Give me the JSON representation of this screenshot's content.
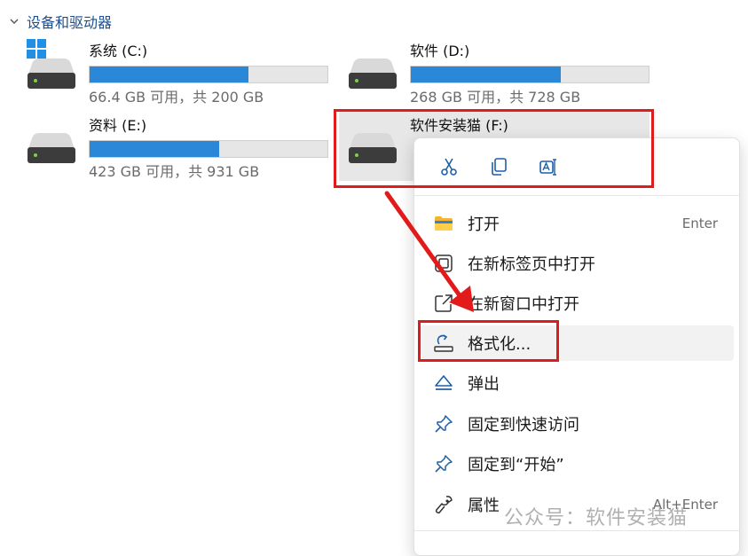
{
  "section": {
    "title": "设备和驱动器"
  },
  "drives": [
    {
      "name": "系统 (C:)",
      "space": "66.4 GB 可用，共 200 GB",
      "used_fraction": 0.668,
      "has_windows_logo": true
    },
    {
      "name": "软件 (D:)",
      "space": "268 GB 可用，共 728 GB",
      "used_fraction": 0.632
    },
    {
      "name": "资料 (E:)",
      "space": "423 GB 可用，共 931 GB",
      "used_fraction": 0.545
    },
    {
      "name": "软件安装猫 (F:)",
      "selected": true
    }
  ],
  "context_menu": {
    "quick_actions": [
      {
        "icon": "cut-icon"
      },
      {
        "icon": "copy-icon"
      },
      {
        "icon": "rename-icon"
      }
    ],
    "items": [
      {
        "label": "打开",
        "shortcut": "Enter",
        "icon": "folder-icon"
      },
      {
        "label": "在新标签页中打开",
        "icon": "new-tab-icon"
      },
      {
        "label": "在新窗口中打开",
        "icon": "open-external-icon"
      },
      {
        "label": "格式化...",
        "icon": "format-icon",
        "hover": true
      },
      {
        "label": "弹出",
        "icon": "eject-icon"
      },
      {
        "label": "固定到快速访问",
        "icon": "pin-icon"
      },
      {
        "label": "固定到“开始”",
        "icon": "pin-icon"
      },
      {
        "label": "属性",
        "shortcut": "Alt+Enter",
        "icon": "wrench-icon"
      }
    ]
  },
  "watermark": "公众号：软件安装猫",
  "colors": {
    "accent": "#2b87d8",
    "highlight": "#e21a1a",
    "header": "#1b4f8f"
  }
}
